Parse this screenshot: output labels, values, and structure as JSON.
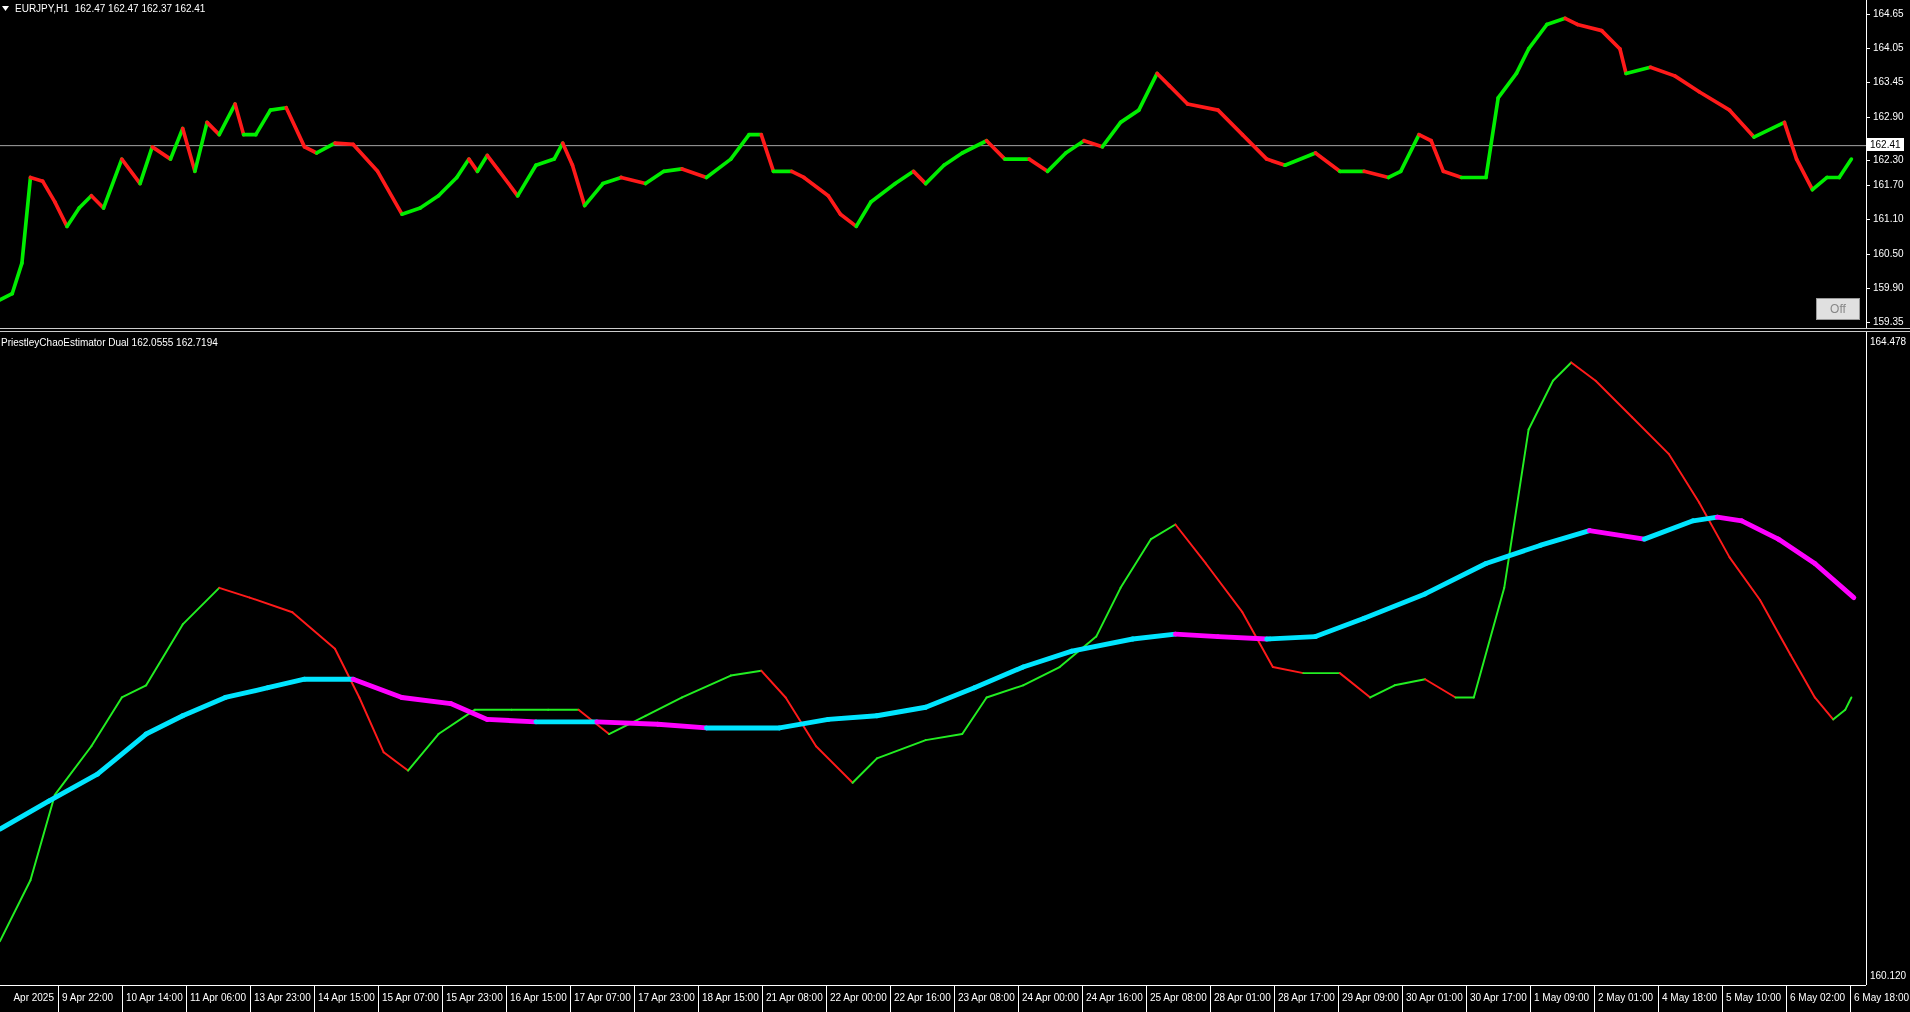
{
  "header": {
    "symbol": "EURJPY,H1",
    "ohlc": "162.47 162.47 162.37 162.41"
  },
  "price_axis": {
    "labels": [
      "164.65",
      "164.05",
      "163.45",
      "162.90",
      "162.30",
      "161.70",
      "161.10",
      "160.50",
      "159.90",
      "159.35"
    ],
    "current_price": "162.41"
  },
  "off_button": {
    "label": "Off"
  },
  "indicator": {
    "label": "PriestleyChaoEstimator Dual 162.0555 162.7194",
    "axis_labels": [
      "164.478",
      "160.120"
    ]
  },
  "time_axis": {
    "labels": [
      "Apr 2025",
      "9 Apr 22:00",
      "10 Apr 14:00",
      "11 Apr 06:00",
      "13 Apr 23:00",
      "14 Apr 15:00",
      "15 Apr 07:00",
      "15 Apr 23:00",
      "16 Apr 15:00",
      "17 Apr 07:00",
      "17 Apr 23:00",
      "18 Apr 15:00",
      "21 Apr 08:00",
      "22 Apr 00:00",
      "22 Apr 16:00",
      "23 Apr 08:00",
      "24 Apr 00:00",
      "24 Apr 16:00",
      "25 Apr 08:00",
      "28 Apr 01:00",
      "28 Apr 17:00",
      "29 Apr 09:00",
      "30 Apr 01:00",
      "30 Apr 17:00",
      "1 May 09:00",
      "2 May 01:00",
      "4 May 18:00",
      "5 May 10:00",
      "6 May 02:00",
      "6 May 18:00"
    ]
  }
}
